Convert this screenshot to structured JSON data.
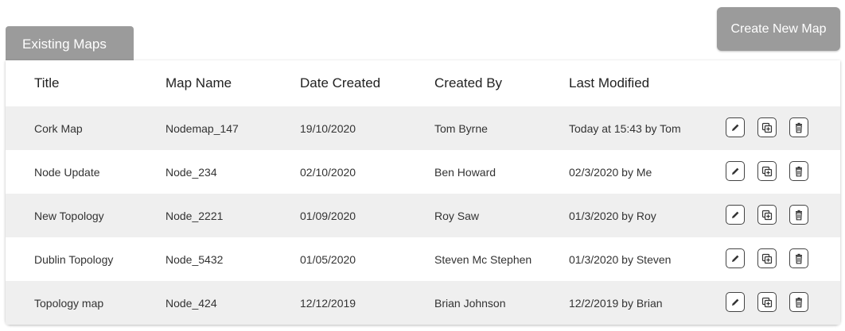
{
  "tab_label": "Existing Maps",
  "create_button_label": "Create New Map",
  "columns": [
    "Title",
    "Map Name",
    "Date Created",
    "Created By",
    "Last Modified"
  ],
  "rows": [
    {
      "title": "Cork Map",
      "map_name": "Nodemap_147",
      "date_created": "19/10/2020",
      "created_by": "Tom Byrne",
      "last_modified": "Today at 15:43 by Tom"
    },
    {
      "title": "Node Update",
      "map_name": "Node_234",
      "date_created": "02/10/2020",
      "created_by": "Ben Howard",
      "last_modified": "02/3/2020 by Me"
    },
    {
      "title": "New Topology",
      "map_name": "Node_2221",
      "date_created": "01/09/2020",
      "created_by": "Roy Saw",
      "last_modified": "01/3/2020 by Roy"
    },
    {
      "title": "Dublin Topology",
      "map_name": "Node_5432",
      "date_created": "01/05/2020",
      "created_by": "Steven Mc Stephen",
      "last_modified": "01/3/2020 by Steven"
    },
    {
      "title": "Topology map",
      "map_name": "Node_424",
      "date_created": "12/12/2019",
      "created_by": "Brian Johnson",
      "last_modified": "12/2/2019 by Brian"
    }
  ],
  "row_actions": [
    "edit-icon",
    "duplicate-icon",
    "delete-icon"
  ],
  "colors": {
    "tab_bg": "#9b9b9b",
    "row_shade": "#efefef",
    "text": "#222222"
  }
}
